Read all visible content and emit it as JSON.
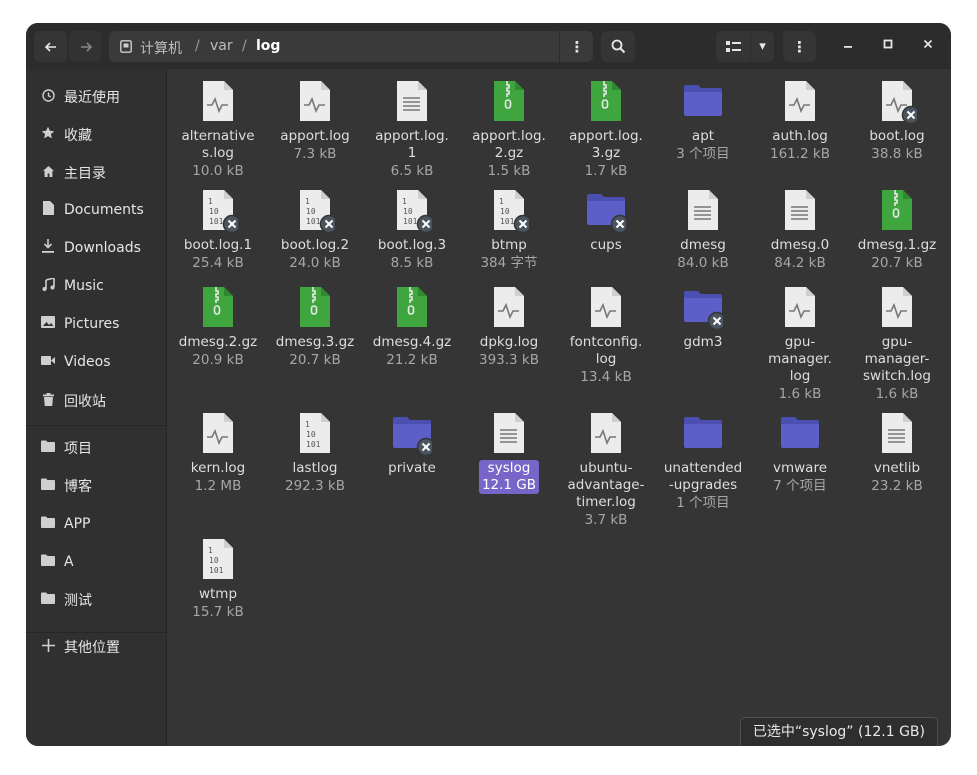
{
  "window": {
    "path": [
      "计算机",
      "var",
      "log"
    ],
    "path_sep": "/"
  },
  "header": {
    "back_icon": "←",
    "forward_icon": "→",
    "menu_icon": "⋮",
    "search_icon": "search",
    "view_icon": "list",
    "dropdown_icon": "▾",
    "more_icon": "⋮",
    "minimize": "–",
    "maximize": "◻",
    "close": "✕"
  },
  "sidebar": {
    "items": [
      {
        "label": "最近使用",
        "icon": "recent-icon"
      },
      {
        "label": "收藏",
        "icon": "star-icon"
      },
      {
        "label": "主目录",
        "icon": "home-icon"
      },
      {
        "label": "Documents",
        "icon": "document-icon"
      },
      {
        "label": "Downloads",
        "icon": "download-icon"
      },
      {
        "label": "Music",
        "icon": "music-icon"
      },
      {
        "label": "Pictures",
        "icon": "picture-icon"
      },
      {
        "label": "Videos",
        "icon": "video-icon"
      },
      {
        "label": "回收站",
        "icon": "trash-icon"
      },
      {
        "label": "项目",
        "icon": "folder-icon"
      },
      {
        "label": "博客",
        "icon": "folder-icon"
      },
      {
        "label": "APP",
        "icon": "folder-icon"
      },
      {
        "label": "A",
        "icon": "folder-icon"
      },
      {
        "label": "测试",
        "icon": "folder-icon"
      },
      {
        "label": "其他位置",
        "icon": "plus-icon"
      }
    ]
  },
  "files": [
    {
      "name": "alternatives.log",
      "display": "alternative\ns.log",
      "size": "10.0 kB",
      "type": "log"
    },
    {
      "name": "apport.log",
      "display": "apport.log",
      "size": "7.3 kB",
      "type": "log"
    },
    {
      "name": "apport.log.1",
      "display": "apport.log.\n1",
      "size": "6.5 kB",
      "type": "text"
    },
    {
      "name": "apport.log.2.gz",
      "display": "apport.log.\n2.gz",
      "size": "1.5 kB",
      "type": "archive"
    },
    {
      "name": "apport.log.3.gz",
      "display": "apport.log.\n3.gz",
      "size": "1.7 kB",
      "type": "archive"
    },
    {
      "name": "apt",
      "display": "apt",
      "size": "3 个项目",
      "type": "folder"
    },
    {
      "name": "auth.log",
      "display": "auth.log",
      "size": "161.2 kB",
      "type": "log"
    },
    {
      "name": "boot.log",
      "display": "boot.log",
      "size": "38.8 kB",
      "type": "log-locked"
    },
    {
      "name": "boot.log.1",
      "display": "boot.log.1",
      "size": "25.4 kB",
      "type": "binary-locked"
    },
    {
      "name": "boot.log.2",
      "display": "boot.log.2",
      "size": "24.0 kB",
      "type": "binary-locked"
    },
    {
      "name": "boot.log.3",
      "display": "boot.log.3",
      "size": "8.5 kB",
      "type": "binary-locked"
    },
    {
      "name": "btmp",
      "display": "btmp",
      "size": "384 字节",
      "type": "binary-locked"
    },
    {
      "name": "cups",
      "display": "cups",
      "size": "",
      "type": "folder-locked"
    },
    {
      "name": "dmesg",
      "display": "dmesg",
      "size": "84.0 kB",
      "type": "text"
    },
    {
      "name": "dmesg.0",
      "display": "dmesg.0",
      "size": "84.2 kB",
      "type": "text"
    },
    {
      "name": "dmesg.1.gz",
      "display": "dmesg.1.gz",
      "size": "20.7 kB",
      "type": "archive"
    },
    {
      "name": "dmesg.2.gz",
      "display": "dmesg.2.gz",
      "size": "20.9 kB",
      "type": "archive"
    },
    {
      "name": "dmesg.3.gz",
      "display": "dmesg.3.gz",
      "size": "20.7 kB",
      "type": "archive"
    },
    {
      "name": "dmesg.4.gz",
      "display": "dmesg.4.gz",
      "size": "21.2 kB",
      "type": "archive"
    },
    {
      "name": "dpkg.log",
      "display": "dpkg.log",
      "size": "393.3 kB",
      "type": "log"
    },
    {
      "name": "fontconfig.log",
      "display": "fontconfig.\nlog",
      "size": "13.4 kB",
      "type": "log"
    },
    {
      "name": "gdm3",
      "display": "gdm3",
      "size": "",
      "type": "folder-locked"
    },
    {
      "name": "gpu-manager.log",
      "display": "gpu-\nmanager.\nlog",
      "size": "1.6 kB",
      "type": "log"
    },
    {
      "name": "gpu-manager-switch.log",
      "display": "gpu-\nmanager-\nswitch.log",
      "size": "1.6 kB",
      "type": "log"
    },
    {
      "name": "kern.log",
      "display": "kern.log",
      "size": "1.2 MB",
      "type": "log"
    },
    {
      "name": "lastlog",
      "display": "lastlog",
      "size": "292.3 kB",
      "type": "binary"
    },
    {
      "name": "private",
      "display": "private",
      "size": "",
      "type": "folder-locked"
    },
    {
      "name": "syslog",
      "display": "syslog",
      "size": "12.1 GB",
      "type": "text",
      "selected": true
    },
    {
      "name": "ubuntu-advantage-timer.log",
      "display": "ubuntu-\nadvantage-\ntimer.log",
      "size": "3.7 kB",
      "type": "log"
    },
    {
      "name": "unattended-upgrades",
      "display": "unattended\n-upgrades",
      "size": "1 个项目",
      "type": "folder"
    },
    {
      "name": "vmware",
      "display": "vmware",
      "size": "7 个项目",
      "type": "folder"
    },
    {
      "name": "vnetlib",
      "display": "vnetlib",
      "size": "23.2 kB",
      "type": "text"
    },
    {
      "name": "wtmp",
      "display": "wtmp",
      "size": "15.7 kB",
      "type": "binary"
    }
  ],
  "status": "已选中“syslog” (12.1 GB)",
  "colors": {
    "folder": "#5b5fc7",
    "archive": "#3fa63f",
    "selection": "#7766c7",
    "badge": "#4a5560"
  }
}
